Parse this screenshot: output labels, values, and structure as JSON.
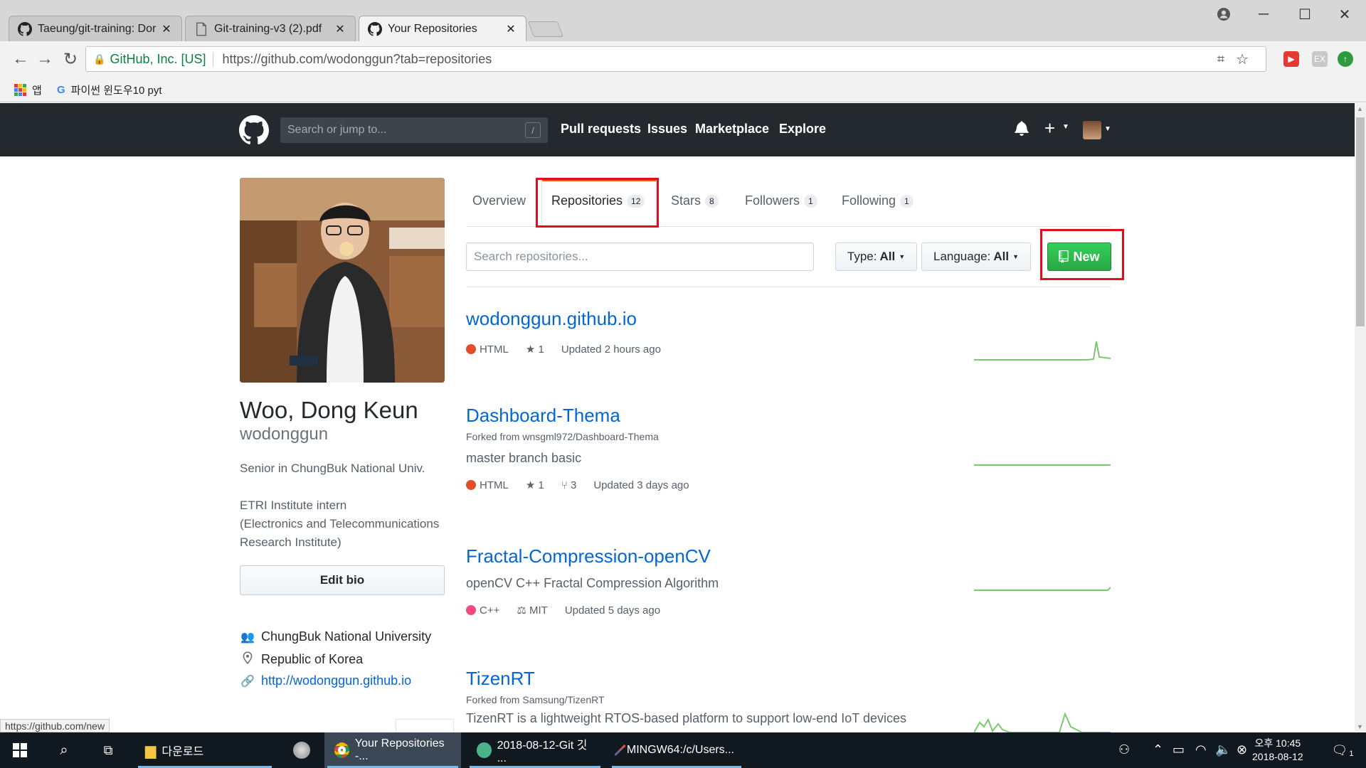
{
  "browser": {
    "tabs": [
      {
        "label": "Taeung/git-training: Dor"
      },
      {
        "label": "Git-training-v3 (2).pdf"
      },
      {
        "label": "Your Repositories"
      }
    ],
    "omnibox": {
      "secure_label": "GitHub, Inc. [US]",
      "url": "https://github.com/wodonggun?tab=repositories"
    },
    "bookmarks": [
      {
        "label": "앱"
      },
      {
        "label": "파이썬 윈도우10 pyt"
      }
    ],
    "status_url": "https://github.com/new"
  },
  "header": {
    "search_placeholder": "Search or jump to...",
    "search_key": "/",
    "nav": [
      "Pull requests",
      "Issues",
      "Marketplace",
      "Explore"
    ],
    "plus": "+"
  },
  "profile": {
    "full_name": "Woo, Dong Keun",
    "username": "wodonggun",
    "bio_lines": [
      "Senior in ChungBuk National Univ.",
      "",
      "ETRI Institute intern",
      "(Electronics and Telecommunications",
      "Research Institute)"
    ],
    "edit_bio": "Edit bio",
    "organization": "ChungBuk National University",
    "location": "Republic of Korea",
    "website": "http://wodonggun.github.io"
  },
  "tabs": [
    {
      "label": "Overview",
      "count": ""
    },
    {
      "label": "Repositories",
      "count": "12"
    },
    {
      "label": "Stars",
      "count": "8"
    },
    {
      "label": "Followers",
      "count": "1"
    },
    {
      "label": "Following",
      "count": "1"
    }
  ],
  "filters": {
    "search_placeholder": "Search repositories...",
    "type_label": "Type:",
    "type_value": "All",
    "language_label": "Language:",
    "language_value": "All",
    "new_label": "New"
  },
  "repos": [
    {
      "name": "wodonggun.github.io",
      "fork": "",
      "description": "",
      "language": "HTML",
      "language_color": "#e34c26",
      "stars": "1",
      "forks": "",
      "license": "",
      "updated": "Updated 2 hours ago"
    },
    {
      "name": "Dashboard-Thema",
      "fork": "Forked from wnsgml972/Dashboard-Thema",
      "description": "master branch basic",
      "language": "HTML",
      "language_color": "#e34c26",
      "stars": "1",
      "forks": "3",
      "license": "",
      "updated": "Updated 3 days ago"
    },
    {
      "name": "Fractal-Compression-openCV",
      "fork": "",
      "description": "openCV C++ Fractal Compression Algorithm",
      "language": "C++",
      "language_color": "#f34b7d",
      "stars": "",
      "forks": "",
      "license": "MIT",
      "updated": "Updated 5 days ago"
    },
    {
      "name": "TizenRT",
      "fork": "Forked from Samsung/TizenRT",
      "description": "TizenRT is a lightweight RTOS-based platform to support low-end IoT devices",
      "language": "",
      "language_color": "",
      "stars": "",
      "forks": "",
      "license": "",
      "updated": ""
    }
  ],
  "taskbar": {
    "apps": [
      {
        "label": "다운로드"
      },
      {
        "label": "Your Repositories -..."
      },
      {
        "label": "2018-08-12-Git 깃 ..."
      },
      {
        "label": "MINGW64:/c/Users..."
      }
    ],
    "time": "오후 10:45",
    "date": "2018-08-12",
    "notifications": "1"
  },
  "colors": {
    "accent_highlight": "#e10e1e",
    "new_button": "#28a745",
    "link": "#0366d6",
    "header_bg": "#24292e"
  }
}
